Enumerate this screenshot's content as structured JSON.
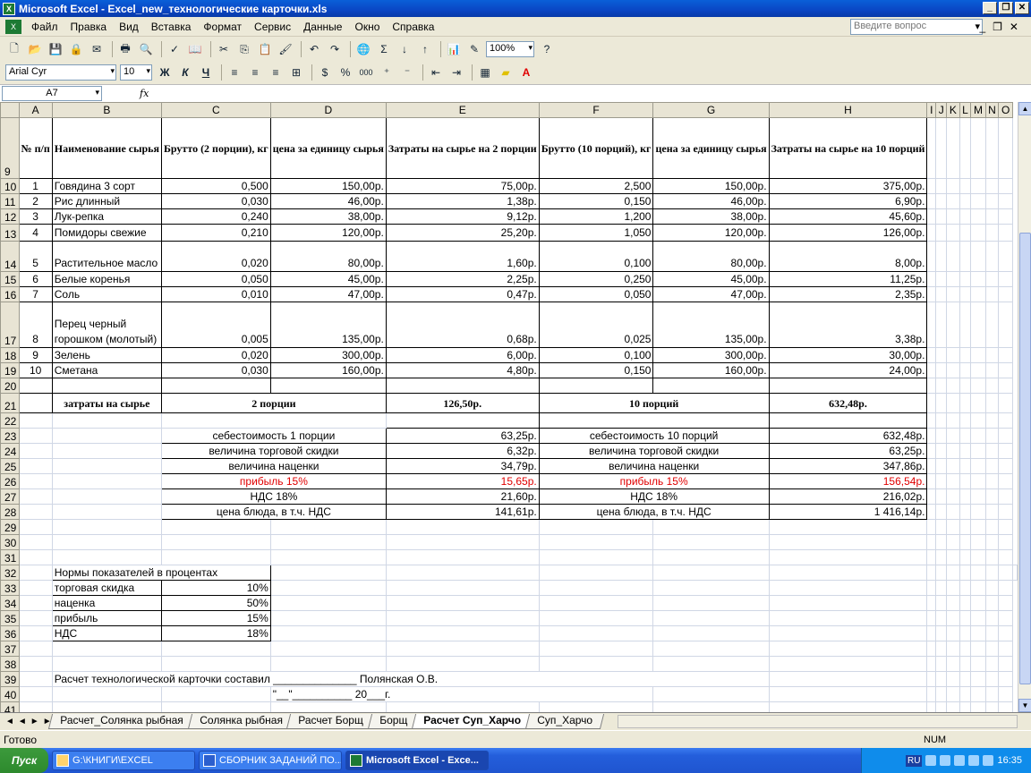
{
  "window": {
    "title": "Microsoft Excel - Excel_new_технологические карточки.xls"
  },
  "menu": {
    "items": [
      "Файл",
      "Правка",
      "Вид",
      "Вставка",
      "Формат",
      "Сервис",
      "Данные",
      "Окно",
      "Справка"
    ],
    "ask_placeholder": "Введите вопрос"
  },
  "toolbar": {
    "zoom": "100%",
    "font_name": "Arial Cyr",
    "font_size": "10",
    "bold": "Ж",
    "italic": "К",
    "underline": "Ч",
    "percent": "%",
    "thousands": "000"
  },
  "formula_bar": {
    "cell_ref": "A7",
    "fx": "fx"
  },
  "columns": [
    "A",
    "B",
    "C",
    "D",
    "E",
    "F",
    "G",
    "H",
    "I",
    "J",
    "K",
    "L",
    "M",
    "N",
    "O"
  ],
  "rows": {
    "r9": {
      "num": "9",
      "a": "№ п/п",
      "b": "Наименование сырья",
      "c": "Брутто (2 порции), кг",
      "d": "цена за единицу сырья",
      "e": "Затраты на сырье на 2 порции",
      "f": "Брутто (10 порций), кг",
      "g": "цена за единицу сырья",
      "h": "Затраты на сырье на 10 порций"
    },
    "items": [
      {
        "num": "10",
        "a": "1",
        "b": "Говядина 3 сорт",
        "c": "0,500",
        "d": "150,00р.",
        "e": "75,00р.",
        "f": "2,500",
        "g": "150,00р.",
        "h": "375,00р."
      },
      {
        "num": "11",
        "a": "2",
        "b": "Рис длинный",
        "c": "0,030",
        "d": "46,00р.",
        "e": "1,38р.",
        "f": "0,150",
        "g": "46,00р.",
        "h": "6,90р."
      },
      {
        "num": "12",
        "a": "3",
        "b": "Лук-репка",
        "c": "0,240",
        "d": "38,00р.",
        "e": "9,12р.",
        "f": "1,200",
        "g": "38,00р.",
        "h": "45,60р."
      },
      {
        "num": "13",
        "a": "4",
        "b": "Помидоры свежие",
        "c": "0,210",
        "d": "120,00р.",
        "e": "25,20р.",
        "f": "1,050",
        "g": "120,00р.",
        "h": "126,00р."
      },
      {
        "num": "14",
        "a": "5",
        "b": "Растительное масло",
        "c": "0,020",
        "d": "80,00р.",
        "e": "1,60р.",
        "f": "0,100",
        "g": "80,00р.",
        "h": "8,00р."
      },
      {
        "num": "15",
        "a": "6",
        "b": "Белые коренья",
        "c": "0,050",
        "d": "45,00р.",
        "e": "2,25р.",
        "f": "0,250",
        "g": "45,00р.",
        "h": "11,25р."
      },
      {
        "num": "16",
        "a": "7",
        "b": "Соль",
        "c": "0,010",
        "d": "47,00р.",
        "e": "0,47р.",
        "f": "0,050",
        "g": "47,00р.",
        "h": "2,35р."
      },
      {
        "num": "17",
        "a": "8",
        "b": "Перец черный горошком (молотый)",
        "c": "0,005",
        "d": "135,00р.",
        "e": "0,68р.",
        "f": "0,025",
        "g": "135,00р.",
        "h": "3,38р."
      },
      {
        "num": "18",
        "a": "9",
        "b": "Зелень",
        "c": "0,020",
        "d": "300,00р.",
        "e": "6,00р.",
        "f": "0,100",
        "g": "300,00р.",
        "h": "30,00р."
      },
      {
        "num": "19",
        "a": "10",
        "b": "Сметана",
        "c": "0,030",
        "d": "160,00р.",
        "e": "4,80р.",
        "f": "0,150",
        "g": "160,00р.",
        "h": "24,00р."
      }
    ],
    "r20": {
      "num": "20"
    },
    "r21": {
      "num": "21",
      "b": "затраты на сырье",
      "cd": "2 порции",
      "e": "126,50р.",
      "fg": "10 порций",
      "h": "632,48р."
    },
    "r22": {
      "num": "22"
    },
    "calc": [
      {
        "num": "23",
        "cd": "себестоимость 1 порции",
        "e": "63,25р.",
        "fg": "себестоимость 10 порций",
        "h": "632,48р.",
        "red": false
      },
      {
        "num": "24",
        "cd": "величина торговой скидки",
        "e": "6,32р.",
        "fg": "величина торговой скидки",
        "h": "63,25р.",
        "red": false
      },
      {
        "num": "25",
        "cd": "величина наценки",
        "e": "34,79р.",
        "fg": "величина наценки",
        "h": "347,86р.",
        "red": false
      },
      {
        "num": "26",
        "cd": "прибыль 15%",
        "e": "15,65р.",
        "fg": "прибыль 15%",
        "h": "156,54р.",
        "red": true
      },
      {
        "num": "27",
        "cd": "НДС 18%",
        "e": "21,60р.",
        "fg": "НДС 18%",
        "h": "216,02р.",
        "red": false
      },
      {
        "num": "28",
        "cd": "цена блюда, в т.ч. НДС",
        "e": "141,61р.",
        "fg": "цена блюда, в т.ч. НДС",
        "h": "1 416,14р.",
        "red": false
      }
    ],
    "r29": {
      "num": "29"
    },
    "r30": {
      "num": "30"
    },
    "r31": {
      "num": "31"
    },
    "norms_title": {
      "num": "32",
      "b": "Нормы показателей в процентах"
    },
    "norms": [
      {
        "num": "33",
        "b": "торговая скидка",
        "c": "10%"
      },
      {
        "num": "34",
        "b": "наценка",
        "c": "50%"
      },
      {
        "num": "35",
        "b": "прибыль",
        "c": "15%"
      },
      {
        "num": "36",
        "b": "НДС",
        "c": "18%"
      }
    ],
    "r37": {
      "num": "37"
    },
    "r38": {
      "num": "38"
    },
    "r39": {
      "num": "39",
      "b": "Расчет технологической карточки составил ______________ Полянская О.В."
    },
    "r40": {
      "num": "40",
      "d": "\"__\"__________ 20___г."
    },
    "r41": {
      "num": "41"
    }
  },
  "tabs": [
    "Расчет_Солянка рыбная",
    "Солянка рыбная",
    "Расчет Борщ",
    "Борщ",
    "Расчет Суп_Харчо",
    "Суп_Харчо"
  ],
  "active_tab": "Расчет Суп_Харчо",
  "status": {
    "ready": "Готово",
    "num": "NUM"
  },
  "taskbar": {
    "start": "Пуск",
    "tasks": [
      "G:\\КНИГИ\\EXCEL",
      "СБОРНИК ЗАДАНИЙ ПО...",
      "Microsoft Excel - Exce..."
    ],
    "lang": "RU",
    "clock": "16:35"
  },
  "colors": {
    "title_bar": "#0a46c4",
    "red_text": "#e00000",
    "header_bg": "#e8e4d4"
  }
}
